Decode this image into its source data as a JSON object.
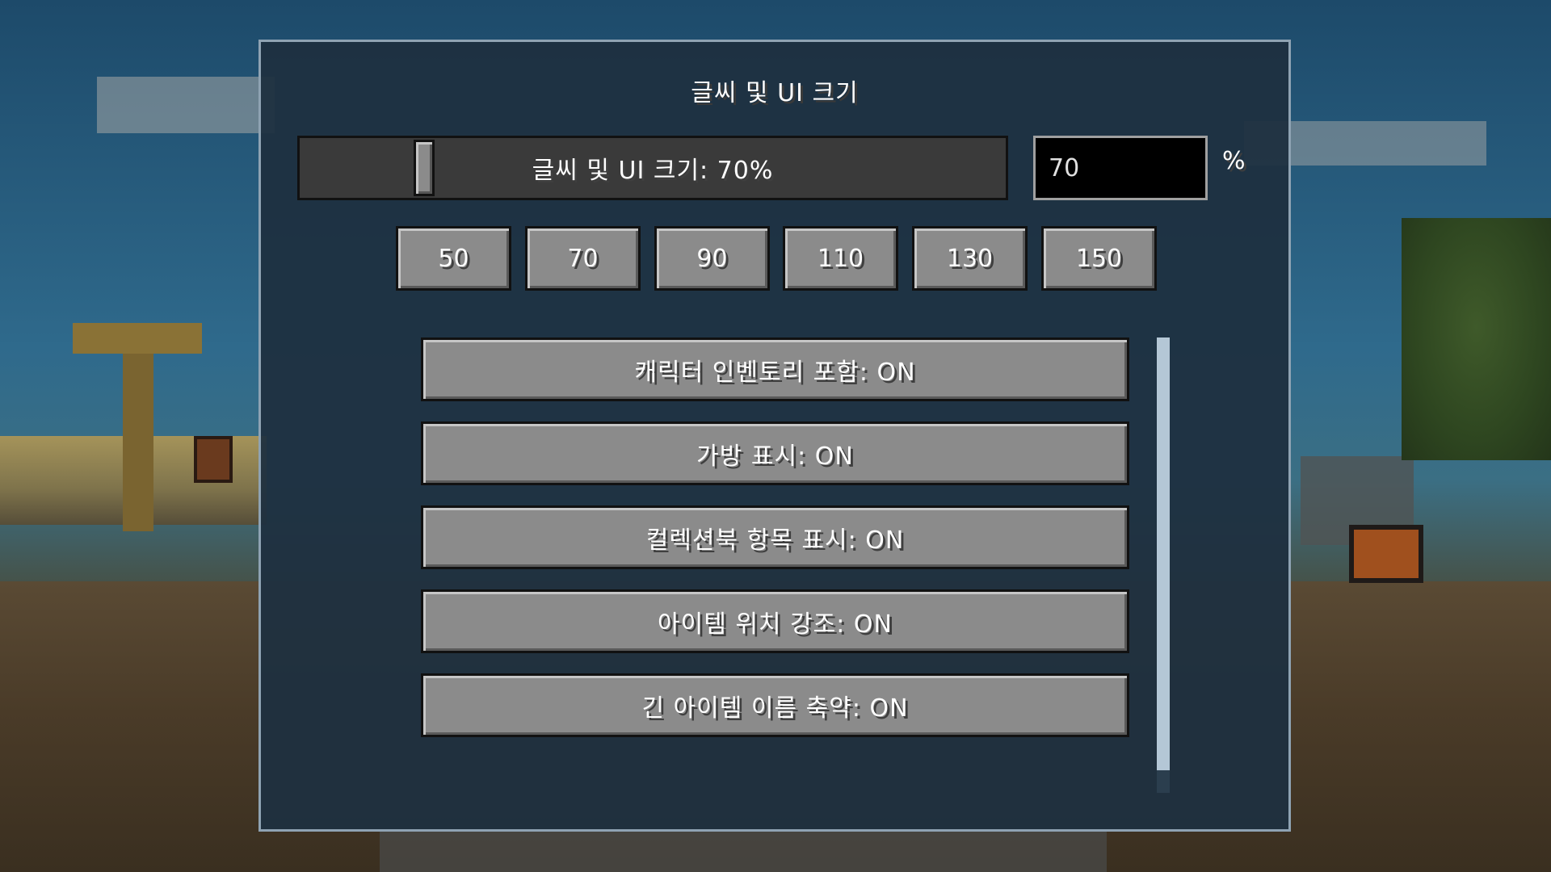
{
  "dialog": {
    "title": "글씨 및 UI 크기"
  },
  "scale_slider": {
    "label": "글씨 및 UI 크기: 70%",
    "value": 70,
    "min": 50,
    "max": 150
  },
  "scale_input": {
    "value": "70",
    "unit": "%"
  },
  "presets": [
    "50",
    "70",
    "90",
    "110",
    "130",
    "150"
  ],
  "options": [
    "캐릭터 인벤토리 포함: ON",
    "가방 표시: ON",
    "컬렉션북 항목 표시: ON",
    "아이템 위치 강조: ON",
    "긴 아이템 이름 축약: ON"
  ],
  "scrollbar": {
    "visible_fraction": 0.95,
    "position": 0
  },
  "colors": {
    "panel_bg": "#1e3040",
    "panel_border": "#8fa3b3",
    "button_face": "#8b8b8b",
    "text": "#ffffff",
    "scroll_thumb": "#b4c7d6"
  }
}
